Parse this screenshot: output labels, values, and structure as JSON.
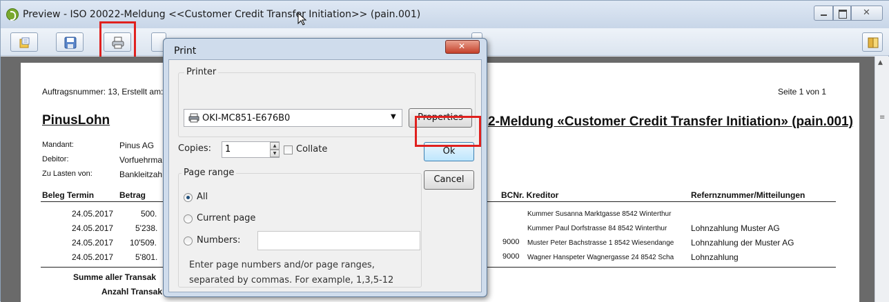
{
  "window": {
    "title": "Preview - ISO 20022-Meldung <<Customer Credit Transfer Initiation>> (pain.001)"
  },
  "toolbar": {
    "buttons": [
      "export-icon",
      "save-icon",
      "print-icon"
    ]
  },
  "report": {
    "order_line": "Auftragsnummer: 13, Erstellt am:",
    "page_info": "Seite 1 von 1",
    "company": "PinusLohn",
    "title_right": "2-Meldung «Customer Credit Transfer Initiation» (pain.001)",
    "meta": [
      {
        "label": "Mandant:",
        "value": "Pinus AG"
      },
      {
        "label": "Debitor:",
        "value": "Vorfuehrma"
      },
      {
        "label": "Zu Lasten von:",
        "value": "Bankleitzah"
      }
    ],
    "columns": {
      "beleg_termin": "Beleg Termin",
      "betrag": "Betrag",
      "bcnr_kreditor": "BCNr. Kreditor",
      "referenz": "Refernznummer/Mitteilungen"
    },
    "rows": [
      {
        "date": "24.05.2017",
        "amount": "500.",
        "bcnr": "",
        "kreditor": "Kummer Susanna Marktgasse 8542 Winterthur",
        "ref": ""
      },
      {
        "date": "24.05.2017",
        "amount": "5'238.",
        "bcnr": "",
        "kreditor": "Kummer Paul Dorfstrasse 84 8542 Winterthur",
        "ref": "Lohnzahlung Muster AG"
      },
      {
        "date": "24.05.2017",
        "amount": "10'509.",
        "bcnr": "9000",
        "kreditor": "Muster Peter Bachstrasse 1 8542 Wiesendange",
        "ref": "Lohnzahlung der Muster AG"
      },
      {
        "date": "24.05.2017",
        "amount": "5'801.",
        "bcnr": "9000",
        "kreditor": "Wagner Hanspeter Wagnergasse 24 8542 Scha",
        "ref": "Lohnzahlung"
      }
    ],
    "summary": {
      "sum_label": "Summe aller Transak",
      "count_label": "Anzahl Transak"
    }
  },
  "print_dialog": {
    "title": "Print",
    "printer_group": "Printer",
    "printer_name": "OKI-MC851-E676B0",
    "properties_button": "Properties",
    "copies_label": "Copies:",
    "copies_value": "1",
    "collate_label": "Collate",
    "ok_button": "Ok",
    "cancel_button": "Cancel",
    "page_range_group": "Page range",
    "range_all": "All",
    "range_current": "Current page",
    "range_numbers": "Numbers:",
    "hint_line1": "Enter page numbers and/or page ranges,",
    "hint_line2": "separated by commas. For example, 1,3,5-12"
  }
}
